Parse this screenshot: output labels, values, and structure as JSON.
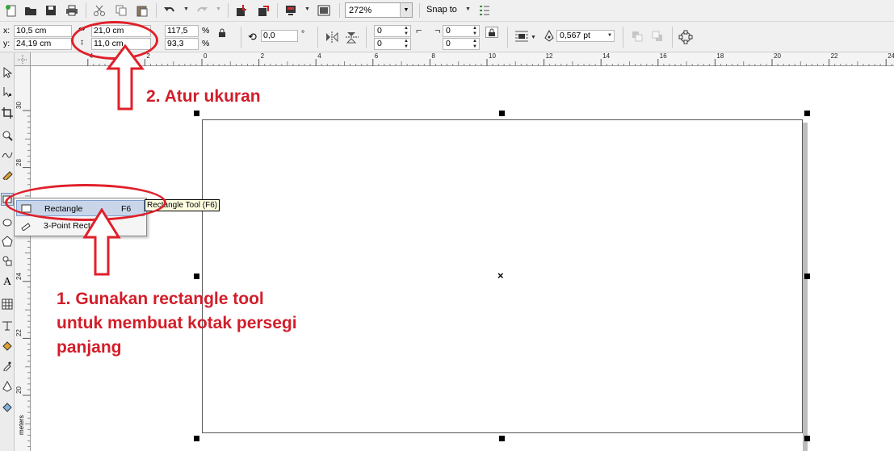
{
  "standard_toolbar": {
    "zoom_value": "272%",
    "snap_label": "Snap to"
  },
  "property_bar": {
    "x_label": "x:",
    "x_value": "10,5 cm",
    "y_label": "y:",
    "y_value": "24,19 cm",
    "width_value": "21,0 cm",
    "height_value": "11,0 cm",
    "scale_x": "117,5",
    "scale_y": "93,3",
    "percent_symbol": "%",
    "rotation_value": "0,0",
    "degree_symbol": "°",
    "corner_tl": "0",
    "corner_bl": "0",
    "corner_tr": "0",
    "corner_br": "0",
    "outline_width": "0,567 pt"
  },
  "ruler": {
    "top_ticks": [
      "4",
      "2",
      "0",
      "2",
      "4",
      "6",
      "8",
      "10",
      "12",
      "14",
      "16",
      "18",
      "20",
      "22",
      "24"
    ],
    "left_ticks": [
      "30",
      "28",
      "26",
      "24",
      "22",
      "20"
    ],
    "unit_label": "meters"
  },
  "flyout": {
    "items": [
      {
        "label": "Rectangle",
        "shortcut": "F6"
      },
      {
        "label": "3-Point Rectangle",
        "shortcut": ""
      }
    ],
    "tooltip": "Rectangle Tool (F6)"
  },
  "annotations": {
    "step1": [
      "1. Gunakan rectangle tool",
      "untuk membuat kotak persegi",
      "panjang"
    ],
    "step2": "2. Atur ukuran",
    "color": "#d21e2a"
  },
  "icons": [
    "new-icon",
    "open-icon",
    "save-icon",
    "print-icon",
    "cut-icon",
    "copy-icon",
    "paste-icon",
    "undo-icon",
    "redo-icon",
    "import-icon",
    "export-icon",
    "application-launcher-icon",
    "welcome-screen-icon",
    "options-icon",
    "lock-ratio-icon",
    "mirror-horizontal-icon",
    "mirror-vertical-icon",
    "corner-lock-icon",
    "wrap-text-icon",
    "outline-pen-icon",
    "to-front-icon",
    "to-back-icon",
    "convert-to-curves-icon"
  ]
}
